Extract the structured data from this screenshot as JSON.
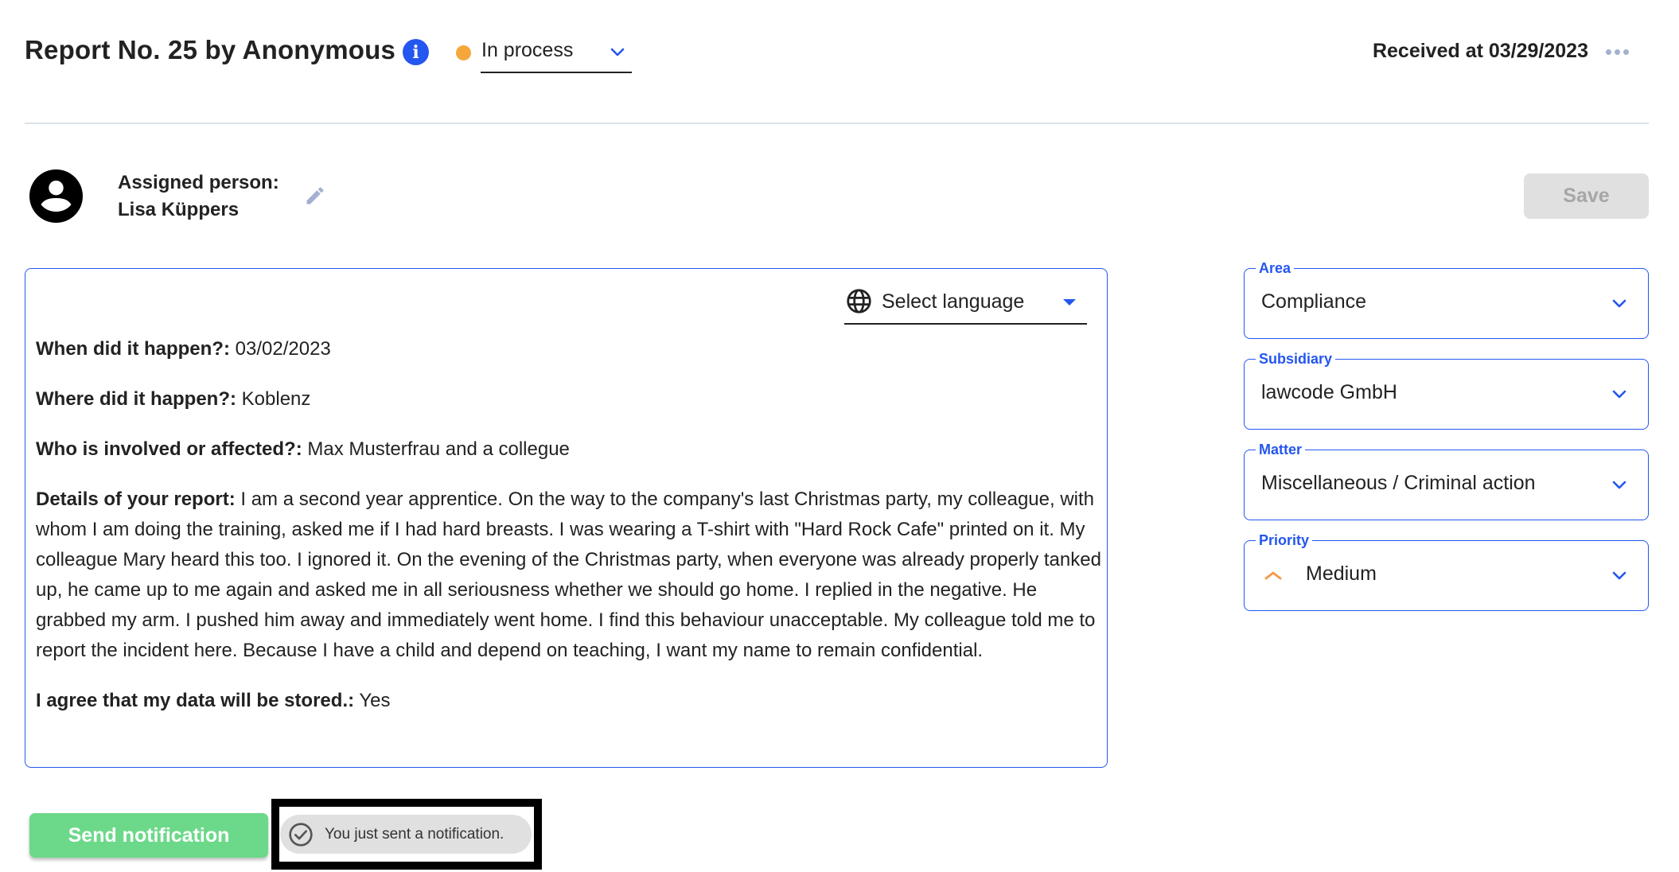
{
  "header": {
    "title": "Report No. 25 by Anonymous",
    "info_icon": "info-icon",
    "status": {
      "value": "In process",
      "dot_color": "#f5a73c"
    },
    "received": "Received at 03/29/2023",
    "more_icon": "more-horizontal-icon"
  },
  "assignee": {
    "label": "Assigned person:",
    "name": "Lisa Küppers",
    "avatar_icon": "account-circle-icon",
    "edit_icon": "pencil-icon"
  },
  "toolbar": {
    "save_label": "Save"
  },
  "report": {
    "language_select": {
      "placeholder": "Select language",
      "icon": "globe-icon"
    },
    "fields": [
      {
        "question": "When did it happen?:",
        "answer": "03/02/2023"
      },
      {
        "question": "Where did it happen?:",
        "answer": "Koblenz"
      },
      {
        "question": "Who is involved or affected?:",
        "answer": "Max Musterfrau and a collegue"
      },
      {
        "question": "Details of your report:",
        "answer": "I am a second year apprentice. On the way to the company's last Christmas party, my colleague, with whom I am doing the training, asked me if I had hard breasts. I was wearing a T-shirt with \"Hard Rock Cafe\" printed on it. My colleague Mary heard this too. I ignored it. On the evening of the Christmas party, when everyone was already properly tanked up, he came up to me again and asked me in all seriousness whether we should go home. I replied in the negative. He grabbed my arm. I pushed him away and immediately went home. I find this behaviour unacceptable. My colleague told me to report the incident here. Because I have a child and depend on teaching, I want my name to remain confidential."
      },
      {
        "question": "I agree that my data will be stored.:",
        "answer": "Yes"
      }
    ]
  },
  "sidebar": {
    "fields": [
      {
        "label": "Area",
        "value": "Compliance"
      },
      {
        "label": "Subsidiary",
        "value": "lawcode GmbH"
      },
      {
        "label": "Matter",
        "value": "Miscellaneous / Criminal action"
      },
      {
        "label": "Priority",
        "value": "Medium",
        "icon": "chevron-up-icon",
        "icon_color": "#f59a4a"
      }
    ]
  },
  "footer": {
    "send_label": "Send notification",
    "toast_text": "You just sent a notification.",
    "toast_icon": "check-circle-icon"
  },
  "colors": {
    "accent": "#2456f0",
    "send_button": "#6cd98a",
    "save_button_disabled": "#e0e0e0",
    "status_in_process": "#f5a73c"
  }
}
